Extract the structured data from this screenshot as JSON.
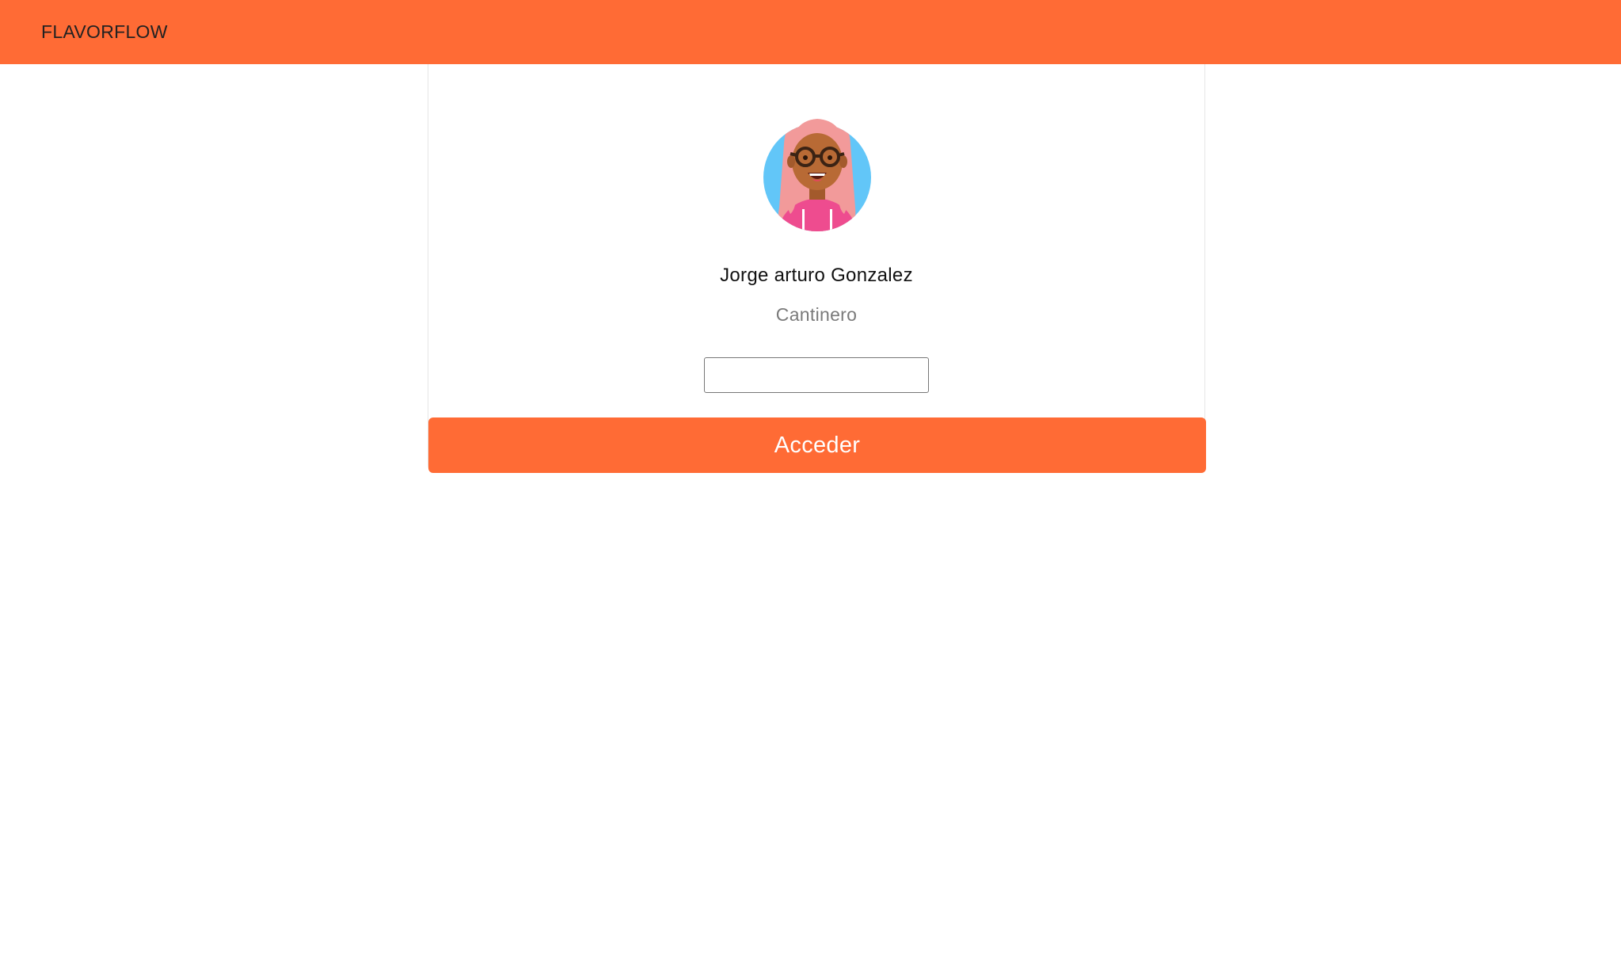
{
  "header": {
    "brand": "FLAVORFLOW",
    "color": "#ff6b35"
  },
  "profile": {
    "avatar_icon": "user-avatar-illustration",
    "name": "Jorge arturo Gonzalez",
    "role": "Cantinero"
  },
  "login": {
    "password_value": "",
    "password_placeholder": "",
    "submit_label": "Acceder"
  }
}
